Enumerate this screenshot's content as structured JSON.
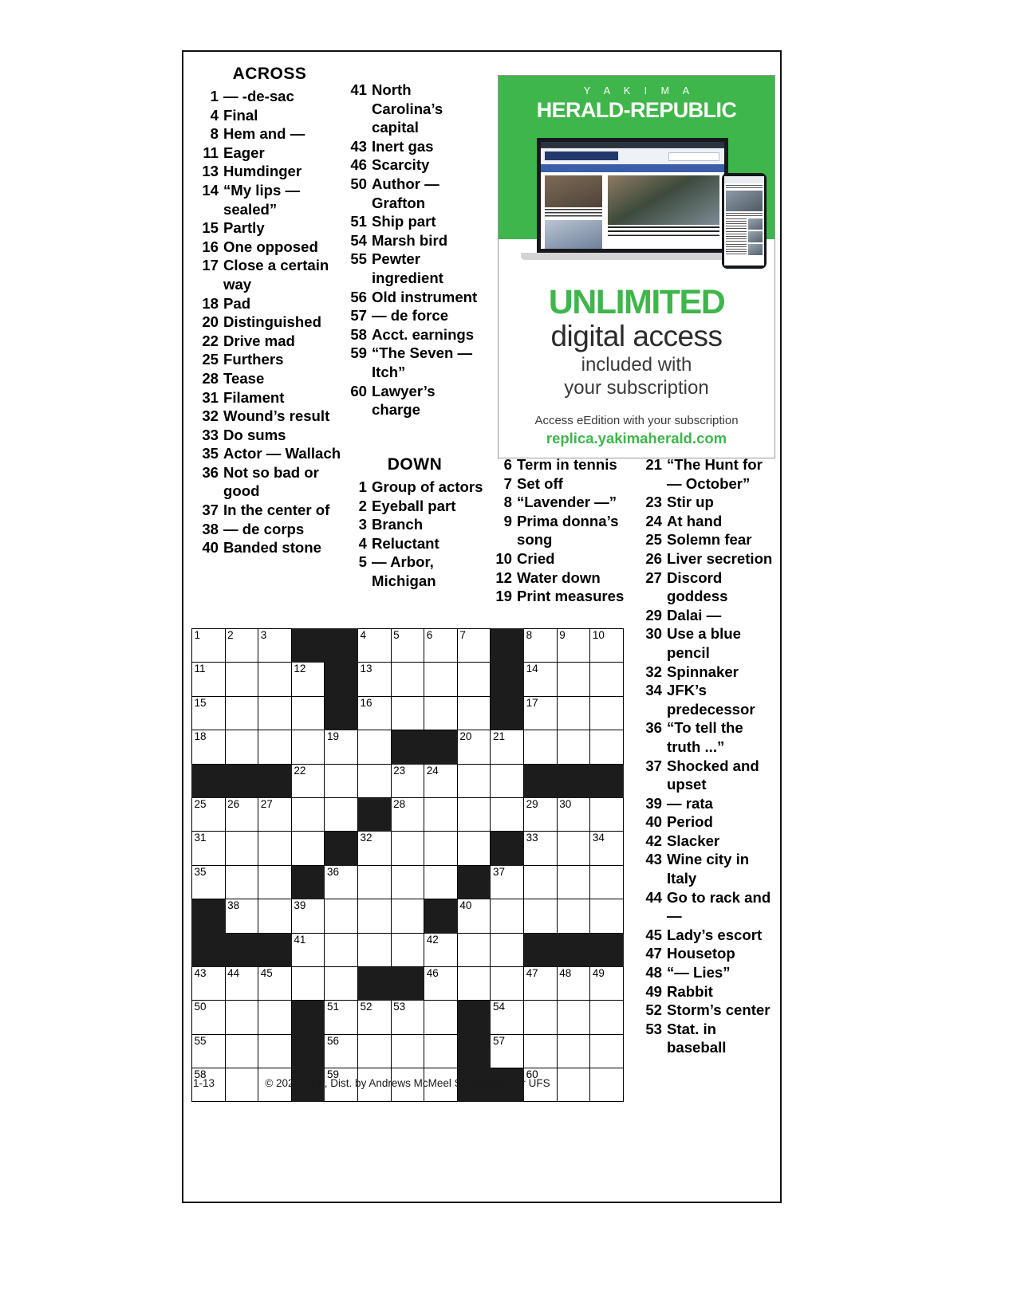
{
  "puzzle": {
    "across_heading": "ACROSS",
    "down_heading": "DOWN",
    "footer_date": "1-13",
    "footer_copyright": "© 2024 UFS, Dist. by Andrews McMeel Syndication for UFS",
    "across_col1": [
      {
        "num": "1",
        "text": "— -de-sac"
      },
      {
        "num": "4",
        "text": "Final"
      },
      {
        "num": "8",
        "text": "Hem and —"
      },
      {
        "num": "11",
        "text": "Eager"
      },
      {
        "num": "13",
        "text": "Humdinger"
      },
      {
        "num": "14",
        "text": "“My lips — sealed”"
      },
      {
        "num": "15",
        "text": "Partly"
      },
      {
        "num": "16",
        "text": "One opposed"
      },
      {
        "num": "17",
        "text": "Close a certain way"
      },
      {
        "num": "18",
        "text": "Pad"
      },
      {
        "num": "20",
        "text": "Distinguished"
      },
      {
        "num": "22",
        "text": "Drive mad"
      },
      {
        "num": "25",
        "text": "Furthers"
      },
      {
        "num": "28",
        "text": "Tease"
      },
      {
        "num": "31",
        "text": "Filament"
      },
      {
        "num": "32",
        "text": "Wound’s result"
      },
      {
        "num": "33",
        "text": "Do sums"
      },
      {
        "num": "35",
        "text": "Actor — Wallach"
      },
      {
        "num": "36",
        "text": "Not so bad or good"
      },
      {
        "num": "37",
        "text": "In the center of"
      },
      {
        "num": "38",
        "text": "— de corps"
      },
      {
        "num": "40",
        "text": "Banded stone"
      }
    ],
    "across_col2": [
      {
        "num": "41",
        "text": "North Carolina’s capital"
      },
      {
        "num": "43",
        "text": "Inert gas"
      },
      {
        "num": "46",
        "text": "Scarcity"
      },
      {
        "num": "50",
        "text": "Author — Grafton"
      },
      {
        "num": "51",
        "text": "Ship part"
      },
      {
        "num": "54",
        "text": "Marsh bird"
      },
      {
        "num": "55",
        "text": "Pewter ingredient"
      },
      {
        "num": "56",
        "text": "Old instrument"
      },
      {
        "num": "57",
        "text": "— de force"
      },
      {
        "num": "58",
        "text": "Acct. earnings"
      },
      {
        "num": "59",
        "text": "“The Seven — Itch”"
      },
      {
        "num": "60",
        "text": "Lawyer’s charge"
      }
    ],
    "down_col1": [
      {
        "num": "1",
        "text": "Group of actors"
      },
      {
        "num": "2",
        "text": "Eyeball part"
      },
      {
        "num": "3",
        "text": "Branch"
      },
      {
        "num": "4",
        "text": "Reluctant"
      },
      {
        "num": "5",
        "text": "— Arbor, Michigan"
      }
    ],
    "down_col2": [
      {
        "num": "6",
        "text": "Term in tennis"
      },
      {
        "num": "7",
        "text": "Set off"
      },
      {
        "num": "8",
        "text": "“Lavender —”"
      },
      {
        "num": "9",
        "text": "Prima donna’s song"
      },
      {
        "num": "10",
        "text": "Cried"
      },
      {
        "num": "12",
        "text": "Water down"
      },
      {
        "num": "19",
        "text": "Print measures"
      }
    ],
    "down_col3": [
      {
        "num": "21",
        "text": "“The Hunt for — October”"
      },
      {
        "num": "23",
        "text": "Stir up"
      },
      {
        "num": "24",
        "text": "At hand"
      },
      {
        "num": "25",
        "text": "Solemn fear"
      },
      {
        "num": "26",
        "text": "Liver secretion"
      },
      {
        "num": "27",
        "text": "Discord goddess"
      },
      {
        "num": "29",
        "text": "Dalai —"
      },
      {
        "num": "30",
        "text": "Use a blue pencil"
      },
      {
        "num": "32",
        "text": "Spinnaker"
      },
      {
        "num": "34",
        "text": "JFK’s predecessor"
      },
      {
        "num": "36",
        "text": "“To tell the truth ...”"
      },
      {
        "num": "37",
        "text": "Shocked and upset"
      },
      {
        "num": "39",
        "text": "— rata"
      },
      {
        "num": "40",
        "text": "Period"
      },
      {
        "num": "42",
        "text": "Slacker"
      },
      {
        "num": "43",
        "text": "Wine city in Italy"
      },
      {
        "num": "44",
        "text": "Go to rack and —"
      },
      {
        "num": "45",
        "text": "Lady’s escort"
      },
      {
        "num": "47",
        "text": "Housetop"
      },
      {
        "num": "48",
        "text": "“— Lies”"
      },
      {
        "num": "49",
        "text": "Rabbit"
      },
      {
        "num": "52",
        "text": "Storm’s center"
      },
      {
        "num": "53",
        "text": "Stat. in baseball"
      }
    ],
    "grid": {
      "cols": 13,
      "rows": 13,
      "cells": [
        [
          {
            "n": "1"
          },
          {
            "n": "2"
          },
          {
            "n": "3"
          },
          {
            "b": 1
          },
          {
            "b": 1
          },
          {
            "n": "4"
          },
          {
            "n": "5"
          },
          {
            "n": "6"
          },
          {
            "n": "7"
          },
          {
            "b": 1
          },
          {
            "n": "8"
          },
          {
            "n": "9"
          },
          {
            "n": "10"
          }
        ],
        [
          {
            "n": "11"
          },
          {},
          {},
          {
            "n": "12"
          },
          {
            "b": 1
          },
          {
            "n": "13"
          },
          {},
          {},
          {},
          {
            "b": 1
          },
          {
            "n": "14"
          },
          {},
          {}
        ],
        [
          {
            "n": "15"
          },
          {},
          {},
          {},
          {
            "b": 1
          },
          {
            "n": "16"
          },
          {},
          {},
          {},
          {
            "b": 1
          },
          {
            "n": "17"
          },
          {},
          {}
        ],
        [
          {
            "n": "18"
          },
          {},
          {},
          {},
          {
            "n": "19"
          },
          {},
          {
            "b": 1
          },
          {
            "b": 1
          },
          {
            "n": "20"
          },
          {
            "n": "21"
          },
          {},
          {},
          {}
        ],
        [
          {
            "b": 1
          },
          {
            "b": 1
          },
          {
            "b": 1
          },
          {
            "n": "22"
          },
          {},
          {},
          {
            "n": "23"
          },
          {
            "n": "24"
          },
          {},
          {},
          {
            "b": 1
          },
          {
            "b": 1
          },
          {
            "b": 1
          }
        ],
        [
          {
            "n": "25"
          },
          {
            "n": "26"
          },
          {
            "n": "27"
          },
          {},
          {},
          {
            "b": 1
          },
          {
            "n": "28"
          },
          {},
          {},
          {},
          {
            "n": "29"
          },
          {
            "n": "30"
          },
          {}
        ],
        [
          {
            "n": "31"
          },
          {},
          {},
          {},
          {
            "b": 1
          },
          {
            "n": "32"
          },
          {},
          {},
          {},
          {
            "b": 1
          },
          {
            "n": "33"
          },
          {},
          {
            "n": "34"
          }
        ],
        [
          {
            "n": "35"
          },
          {},
          {},
          {
            "b": 1
          },
          {
            "n": "36"
          },
          {},
          {},
          {},
          {
            "b": 1
          },
          {
            "n": "37"
          },
          {},
          {},
          {}
        ],
        [
          {
            "b": 1
          },
          {
            "n": "38"
          },
          {},
          {
            "n": "39"
          },
          {},
          {},
          {},
          {
            "b": 1
          },
          {
            "n": "40"
          },
          {},
          {},
          {},
          {}
        ],
        [
          {
            "b": 1
          },
          {
            "b": 1
          },
          {
            "b": 1
          },
          {
            "n": "41"
          },
          {},
          {},
          {},
          {
            "n": "42"
          },
          {},
          {},
          {
            "b": 1
          },
          {
            "b": 1
          },
          {
            "b": 1
          }
        ],
        [
          {
            "n": "43"
          },
          {
            "n": "44"
          },
          {
            "n": "45"
          },
          {},
          {},
          {
            "b": 1
          },
          {
            "b": 1
          },
          {
            "n": "46"
          },
          {},
          {},
          {
            "n": "47"
          },
          {
            "n": "48"
          },
          {
            "n": "49"
          }
        ],
        [
          {
            "n": "50"
          },
          {},
          {},
          {
            "b": 1
          },
          {
            "n": "51"
          },
          {
            "n": "52"
          },
          {
            "n": "53"
          },
          {},
          {
            "b": 1
          },
          {
            "n": "54"
          },
          {},
          {},
          {}
        ],
        [
          {
            "n": "55"
          },
          {},
          {},
          {
            "b": 1
          },
          {
            "n": "56"
          },
          {},
          {},
          {},
          {
            "b": 1
          },
          {
            "n": "57"
          },
          {},
          {},
          {}
        ],
        [
          {
            "n": "58"
          },
          {},
          {},
          {
            "b": 1
          },
          {
            "n": "59"
          },
          {},
          {},
          {},
          {
            "b": 1
          },
          {
            "b": 1
          },
          {
            "n": "60"
          },
          {},
          {}
        ]
      ]
    }
  },
  "ad": {
    "kicker": "Y A K I M A",
    "masthead": "HERALD-REPUBLIC",
    "headline_unlimited": "UNLIMITED",
    "headline_digital": "digital access",
    "sub_line1": "included with",
    "sub_line2": "your subscription",
    "access_note": "Access eEdition with your subscription",
    "url": "replica.yakimaherald.com",
    "green": "#3fb64b"
  }
}
